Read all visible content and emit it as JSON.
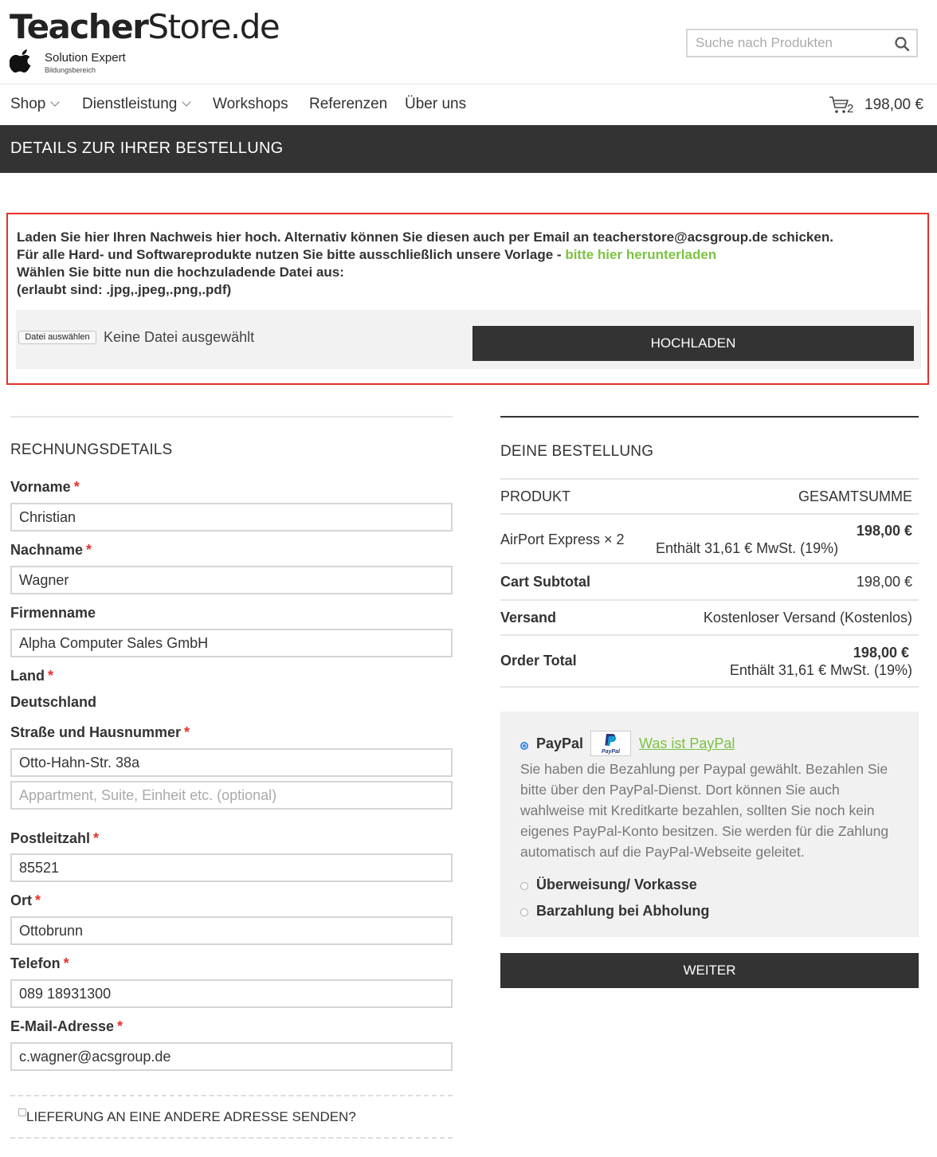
{
  "header": {
    "logo_bold": "Teacher",
    "logo_light": "Store.de",
    "sub_title": "Solution Expert",
    "sub_small": "Bildungsbereich",
    "search_placeholder": "Suche nach Produkten"
  },
  "nav": {
    "items": [
      "Shop",
      "Dienstleistung",
      "Workshops",
      "Referenzen",
      "Über uns"
    ],
    "cart_count": "2",
    "cart_total": "198,00 €"
  },
  "page": {
    "title": "DETAILS ZUR IHRER BESTELLUNG"
  },
  "upload": {
    "line1": "Laden Sie hier Ihren Nachweis hier hoch. Alternativ können Sie diesen auch per Email an teacherstore@acsgroup.de schicken.",
    "line2_prefix": "Für alle Hard- und Softwareprodukte nutzen Sie bitte ausschließlich unsere Vorlage - ",
    "line2_link": "bitte hier herunterladen",
    "line3": "Wählen Sie bitte nun die hochzuladende Datei aus:",
    "line4": "(erlaubt sind: .jpg,.jpeg,.png,.pdf)",
    "file_button": "Datei auswählen",
    "file_status": "Keine Datei ausgewählt",
    "upload_button": "HOCHLADEN"
  },
  "billing": {
    "title": "RECHNUNGSDETAILS",
    "vorname_label": "Vorname",
    "vorname_value": "Christian",
    "nachname_label": "Nachname",
    "nachname_value": "Wagner",
    "firma_label": "Firmenname",
    "firma_value": "Alpha Computer Sales GmbH",
    "land_label": "Land",
    "land_value": "Deutschland",
    "strasse_label": "Straße und Hausnummer",
    "strasse_value": "Otto-Hahn-Str. 38a",
    "address2_placeholder": "Appartment, Suite, Einheit etc. (optional)",
    "plz_label": "Postleitzahl",
    "plz_value": "85521",
    "ort_label": "Ort",
    "ort_value": "Ottobrunn",
    "telefon_label": "Telefon",
    "telefon_value": "089 18931300",
    "email_label": "E-Mail-Adresse",
    "email_value": "c.wagner@acsgroup.de",
    "required_mark": "*",
    "ship_other": "LIEFERUNG AN EINE ANDERE ADRESSE SENDEN?"
  },
  "order": {
    "title": "DEINE BESTELLUNG",
    "col_product": "PRODUKT",
    "col_total": "GESAMTSUMME",
    "item_name": "AirPort Express × 2",
    "item_price": "198,00 €",
    "item_tax": "Enthält 31,61 € MwSt. (19%)",
    "subtotal_label": "Cart Subtotal",
    "subtotal_value": "198,00 €",
    "shipping_label": "Versand",
    "shipping_value": "Kostenloser Versand (Kostenlos)",
    "total_label": "Order Total",
    "total_value": "198,00 €",
    "total_tax": "Enthält 31,61 € MwSt. (19%)"
  },
  "payment": {
    "paypal_label": "PayPal",
    "paypal_logo_text": "PayPal",
    "paypal_link": "Was ist PayPal",
    "paypal_desc": "Sie haben die Bezahlung per Paypal gewählt. Bezahlen Sie bitte über den PayPal-Dienst. Dort können Sie auch wahlweise mit Kreditkarte bezahlen, sollten Sie noch kein eigenes PayPal-Konto besitzen. Sie werden für die Zahlung automatisch auf die PayPal-Webseite geleitet.",
    "transfer_label": "Überweisung/ Vorkasse",
    "cash_label": "Barzahlung bei Abholung",
    "continue_button": "WEITER"
  },
  "colors": {
    "accent_green": "#7cc242",
    "dark_bar": "#333333",
    "required_red": "#e5312b",
    "radio_blue": "#3a8be0"
  }
}
